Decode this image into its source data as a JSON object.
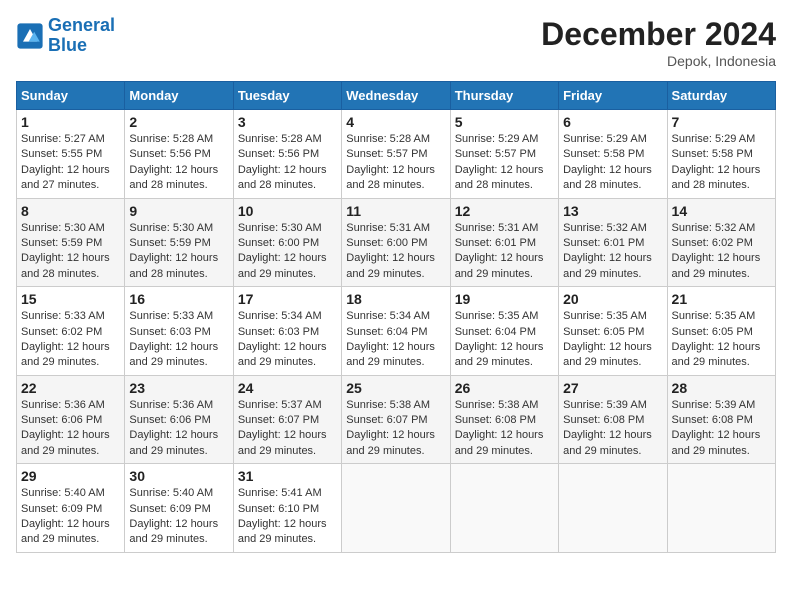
{
  "header": {
    "logo_line1": "General",
    "logo_line2": "Blue",
    "month_title": "December 2024",
    "location": "Depok, Indonesia"
  },
  "days_of_week": [
    "Sunday",
    "Monday",
    "Tuesday",
    "Wednesday",
    "Thursday",
    "Friday",
    "Saturday"
  ],
  "weeks": [
    [
      {
        "day": "1",
        "sunrise": "5:27 AM",
        "sunset": "5:55 PM",
        "daylight": "12 hours and 27 minutes."
      },
      {
        "day": "2",
        "sunrise": "5:28 AM",
        "sunset": "5:56 PM",
        "daylight": "12 hours and 28 minutes."
      },
      {
        "day": "3",
        "sunrise": "5:28 AM",
        "sunset": "5:56 PM",
        "daylight": "12 hours and 28 minutes."
      },
      {
        "day": "4",
        "sunrise": "5:28 AM",
        "sunset": "5:57 PM",
        "daylight": "12 hours and 28 minutes."
      },
      {
        "day": "5",
        "sunrise": "5:29 AM",
        "sunset": "5:57 PM",
        "daylight": "12 hours and 28 minutes."
      },
      {
        "day": "6",
        "sunrise": "5:29 AM",
        "sunset": "5:58 PM",
        "daylight": "12 hours and 28 minutes."
      },
      {
        "day": "7",
        "sunrise": "5:29 AM",
        "sunset": "5:58 PM",
        "daylight": "12 hours and 28 minutes."
      }
    ],
    [
      {
        "day": "8",
        "sunrise": "5:30 AM",
        "sunset": "5:59 PM",
        "daylight": "12 hours and 28 minutes."
      },
      {
        "day": "9",
        "sunrise": "5:30 AM",
        "sunset": "5:59 PM",
        "daylight": "12 hours and 28 minutes."
      },
      {
        "day": "10",
        "sunrise": "5:30 AM",
        "sunset": "6:00 PM",
        "daylight": "12 hours and 29 minutes."
      },
      {
        "day": "11",
        "sunrise": "5:31 AM",
        "sunset": "6:00 PM",
        "daylight": "12 hours and 29 minutes."
      },
      {
        "day": "12",
        "sunrise": "5:31 AM",
        "sunset": "6:01 PM",
        "daylight": "12 hours and 29 minutes."
      },
      {
        "day": "13",
        "sunrise": "5:32 AM",
        "sunset": "6:01 PM",
        "daylight": "12 hours and 29 minutes."
      },
      {
        "day": "14",
        "sunrise": "5:32 AM",
        "sunset": "6:02 PM",
        "daylight": "12 hours and 29 minutes."
      }
    ],
    [
      {
        "day": "15",
        "sunrise": "5:33 AM",
        "sunset": "6:02 PM",
        "daylight": "12 hours and 29 minutes."
      },
      {
        "day": "16",
        "sunrise": "5:33 AM",
        "sunset": "6:03 PM",
        "daylight": "12 hours and 29 minutes."
      },
      {
        "day": "17",
        "sunrise": "5:34 AM",
        "sunset": "6:03 PM",
        "daylight": "12 hours and 29 minutes."
      },
      {
        "day": "18",
        "sunrise": "5:34 AM",
        "sunset": "6:04 PM",
        "daylight": "12 hours and 29 minutes."
      },
      {
        "day": "19",
        "sunrise": "5:35 AM",
        "sunset": "6:04 PM",
        "daylight": "12 hours and 29 minutes."
      },
      {
        "day": "20",
        "sunrise": "5:35 AM",
        "sunset": "6:05 PM",
        "daylight": "12 hours and 29 minutes."
      },
      {
        "day": "21",
        "sunrise": "5:35 AM",
        "sunset": "6:05 PM",
        "daylight": "12 hours and 29 minutes."
      }
    ],
    [
      {
        "day": "22",
        "sunrise": "5:36 AM",
        "sunset": "6:06 PM",
        "daylight": "12 hours and 29 minutes."
      },
      {
        "day": "23",
        "sunrise": "5:36 AM",
        "sunset": "6:06 PM",
        "daylight": "12 hours and 29 minutes."
      },
      {
        "day": "24",
        "sunrise": "5:37 AM",
        "sunset": "6:07 PM",
        "daylight": "12 hours and 29 minutes."
      },
      {
        "day": "25",
        "sunrise": "5:38 AM",
        "sunset": "6:07 PM",
        "daylight": "12 hours and 29 minutes."
      },
      {
        "day": "26",
        "sunrise": "5:38 AM",
        "sunset": "6:08 PM",
        "daylight": "12 hours and 29 minutes."
      },
      {
        "day": "27",
        "sunrise": "5:39 AM",
        "sunset": "6:08 PM",
        "daylight": "12 hours and 29 minutes."
      },
      {
        "day": "28",
        "sunrise": "5:39 AM",
        "sunset": "6:08 PM",
        "daylight": "12 hours and 29 minutes."
      }
    ],
    [
      {
        "day": "29",
        "sunrise": "5:40 AM",
        "sunset": "6:09 PM",
        "daylight": "12 hours and 29 minutes."
      },
      {
        "day": "30",
        "sunrise": "5:40 AM",
        "sunset": "6:09 PM",
        "daylight": "12 hours and 29 minutes."
      },
      {
        "day": "31",
        "sunrise": "5:41 AM",
        "sunset": "6:10 PM",
        "daylight": "12 hours and 29 minutes."
      },
      null,
      null,
      null,
      null
    ]
  ]
}
